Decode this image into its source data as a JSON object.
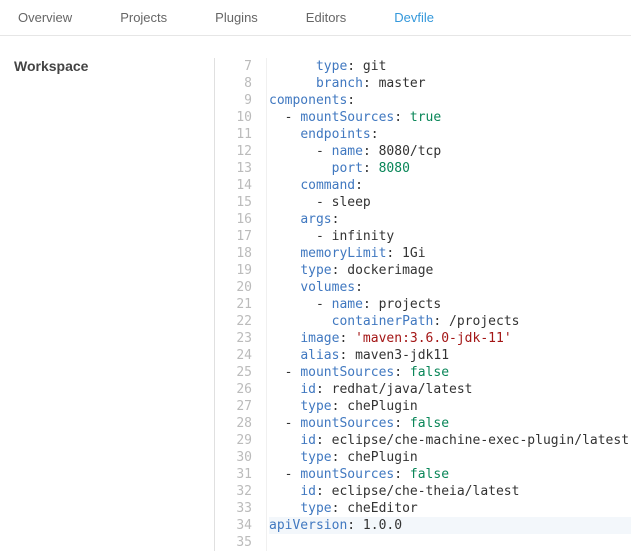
{
  "tabs": {
    "items": [
      "Overview",
      "Projects",
      "Plugins",
      "Editors",
      "Devfile"
    ],
    "active_index": 4
  },
  "sidebar": {
    "title": "Workspace"
  },
  "editor": {
    "first_line": 7,
    "highlight_line": 34,
    "lines": [
      [
        [
          "      ",
          ""
        ],
        [
          "type",
          "key"
        ],
        [
          ": git",
          "plain"
        ]
      ],
      [
        [
          "      ",
          ""
        ],
        [
          "branch",
          "key"
        ],
        [
          ": master",
          "plain"
        ]
      ],
      [
        [
          "components",
          "key"
        ],
        [
          ":",
          "plain"
        ]
      ],
      [
        [
          "  - ",
          ""
        ],
        [
          "mountSources",
          "key"
        ],
        [
          ": ",
          "plain"
        ],
        [
          "true",
          "val"
        ]
      ],
      [
        [
          "    ",
          ""
        ],
        [
          "endpoints",
          "key"
        ],
        [
          ":",
          "plain"
        ]
      ],
      [
        [
          "      - ",
          ""
        ],
        [
          "name",
          "key"
        ],
        [
          ": 8080/tcp",
          "plain"
        ]
      ],
      [
        [
          "        ",
          ""
        ],
        [
          "port",
          "key"
        ],
        [
          ": ",
          "plain"
        ],
        [
          "8080",
          "val"
        ]
      ],
      [
        [
          "    ",
          ""
        ],
        [
          "command",
          "key"
        ],
        [
          ":",
          "plain"
        ]
      ],
      [
        [
          "      - sleep",
          "plain"
        ]
      ],
      [
        [
          "    ",
          ""
        ],
        [
          "args",
          "key"
        ],
        [
          ":",
          "plain"
        ]
      ],
      [
        [
          "      - infinity",
          "plain"
        ]
      ],
      [
        [
          "    ",
          ""
        ],
        [
          "memoryLimit",
          "key"
        ],
        [
          ": 1Gi",
          "plain"
        ]
      ],
      [
        [
          "    ",
          ""
        ],
        [
          "type",
          "key"
        ],
        [
          ": dockerimage",
          "plain"
        ]
      ],
      [
        [
          "    ",
          ""
        ],
        [
          "volumes",
          "key"
        ],
        [
          ":",
          "plain"
        ]
      ],
      [
        [
          "      - ",
          ""
        ],
        [
          "name",
          "key"
        ],
        [
          ": projects",
          "plain"
        ]
      ],
      [
        [
          "        ",
          ""
        ],
        [
          "containerPath",
          "key"
        ],
        [
          ": /projects",
          "plain"
        ]
      ],
      [
        [
          "    ",
          ""
        ],
        [
          "image",
          "key"
        ],
        [
          ": ",
          "plain"
        ],
        [
          "'maven:3.6.0-jdk-11'",
          "str"
        ]
      ],
      [
        [
          "    ",
          ""
        ],
        [
          "alias",
          "key"
        ],
        [
          ": maven3-jdk11",
          "plain"
        ]
      ],
      [
        [
          "  - ",
          ""
        ],
        [
          "mountSources",
          "key"
        ],
        [
          ": ",
          "plain"
        ],
        [
          "false",
          "val"
        ]
      ],
      [
        [
          "    ",
          ""
        ],
        [
          "id",
          "key"
        ],
        [
          ": redhat/java/latest",
          "plain"
        ]
      ],
      [
        [
          "    ",
          ""
        ],
        [
          "type",
          "key"
        ],
        [
          ": chePlugin",
          "plain"
        ]
      ],
      [
        [
          "  - ",
          ""
        ],
        [
          "mountSources",
          "key"
        ],
        [
          ": ",
          "plain"
        ],
        [
          "false",
          "val"
        ]
      ],
      [
        [
          "    ",
          ""
        ],
        [
          "id",
          "key"
        ],
        [
          ": eclipse/che-machine-exec-plugin/latest",
          "plain"
        ]
      ],
      [
        [
          "    ",
          ""
        ],
        [
          "type",
          "key"
        ],
        [
          ": chePlugin",
          "plain"
        ]
      ],
      [
        [
          "  - ",
          ""
        ],
        [
          "mountSources",
          "key"
        ],
        [
          ": ",
          "plain"
        ],
        [
          "false",
          "val"
        ]
      ],
      [
        [
          "    ",
          ""
        ],
        [
          "id",
          "key"
        ],
        [
          ": eclipse/che-theia/latest",
          "plain"
        ]
      ],
      [
        [
          "    ",
          ""
        ],
        [
          "type",
          "key"
        ],
        [
          ": cheEditor",
          "plain"
        ]
      ],
      [
        [
          "apiVersion",
          "key"
        ],
        [
          ": 1.0.0",
          "plain"
        ]
      ],
      [
        [
          "",
          ""
        ]
      ]
    ]
  }
}
